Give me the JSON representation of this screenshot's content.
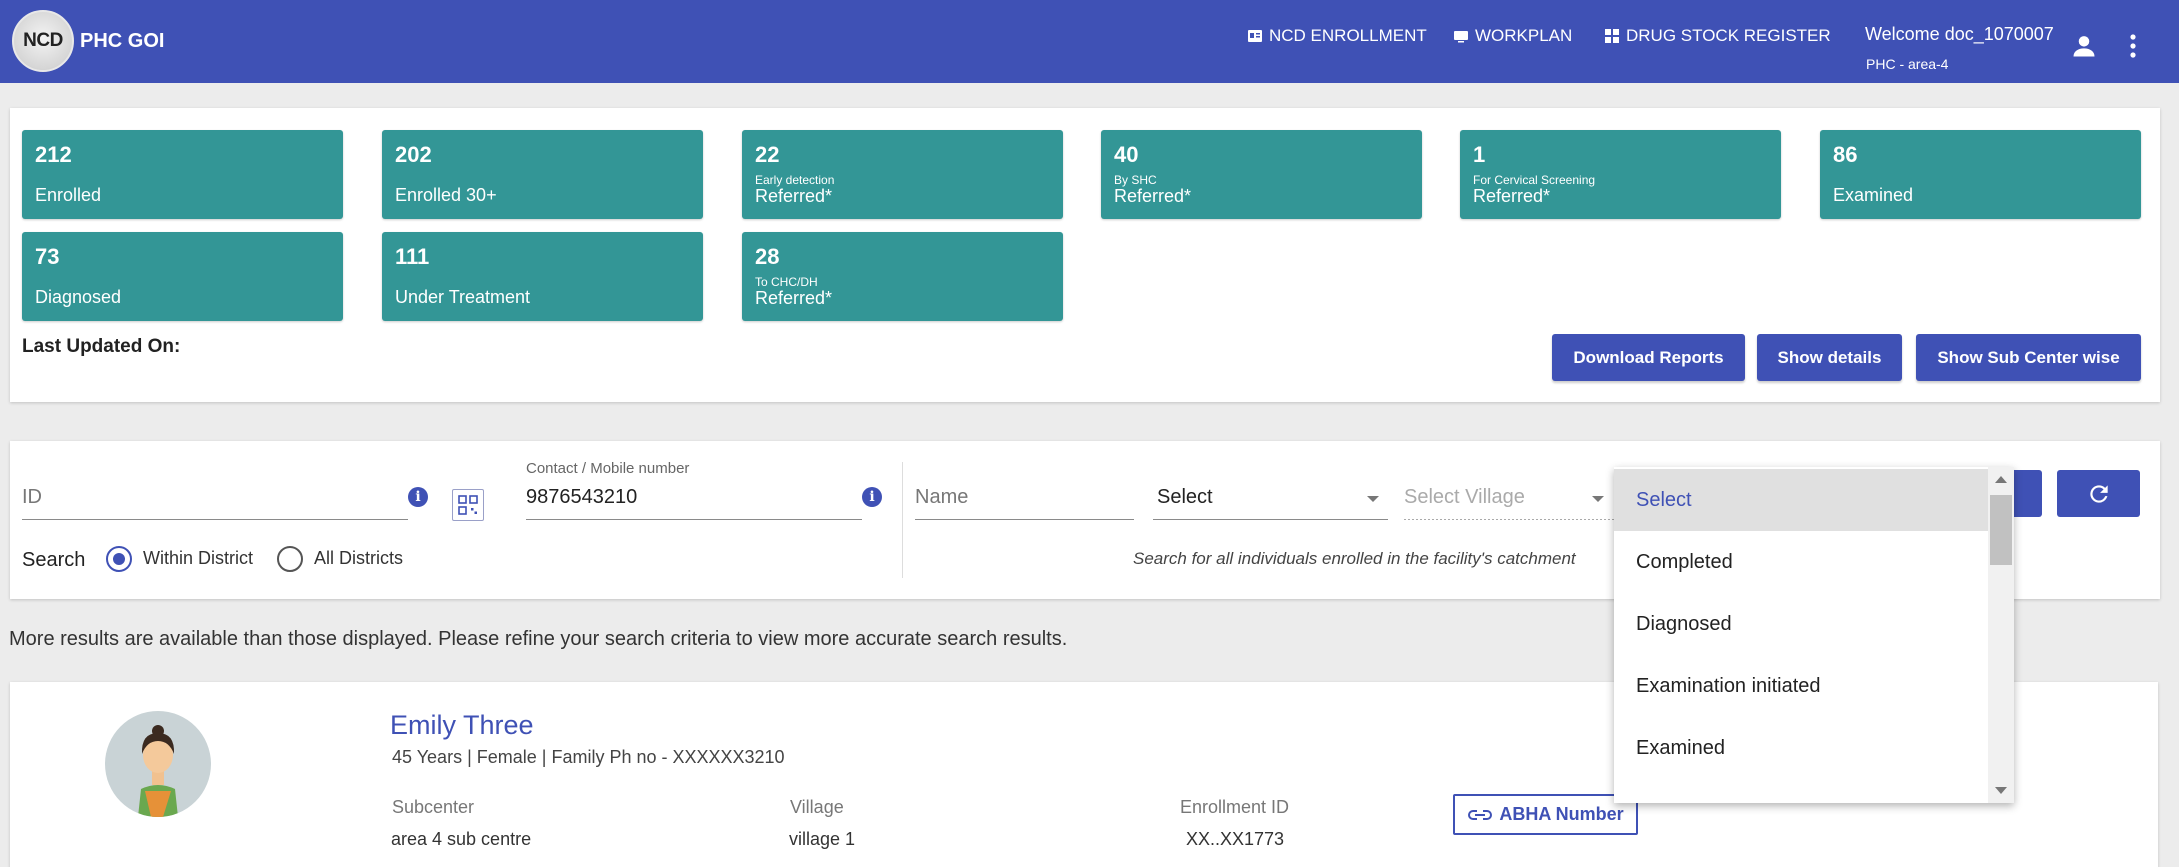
{
  "header": {
    "logo_text": "NCD",
    "app_title": "PHC GOI",
    "nav": [
      {
        "label": "NCD ENROLLMENT",
        "icon": "id-card-icon"
      },
      {
        "label": "WORKPLAN",
        "icon": "monitor-icon"
      },
      {
        "label": "DRUG STOCK REGISTER",
        "icon": "grid-icon"
      }
    ],
    "welcome": "Welcome doc_1070007",
    "facility": "PHC - area-4",
    "colors": {
      "primary": "#3f51b5",
      "card": "#339696"
    }
  },
  "stats": {
    "cards": [
      {
        "value": "212",
        "sub": "",
        "label": "Enrolled"
      },
      {
        "value": "202",
        "sub": "",
        "label": "Enrolled 30+"
      },
      {
        "value": "22",
        "sub": "Early detection",
        "label": "Referred*"
      },
      {
        "value": "40",
        "sub": "By SHC",
        "label": "Referred*"
      },
      {
        "value": "1",
        "sub": "For Cervical Screening",
        "label": "Referred*"
      },
      {
        "value": "86",
        "sub": "",
        "label": "Examined"
      },
      {
        "value": "73",
        "sub": "",
        "label": "Diagnosed"
      },
      {
        "value": "111",
        "sub": "",
        "label": "Under Treatment"
      },
      {
        "value": "28",
        "sub": "To CHC/DH",
        "label": "Referred*"
      }
    ],
    "last_updated": "Last Updated On:",
    "buttons": {
      "download": "Download Reports",
      "details": "Show details",
      "subcenter": "Show Sub Center wise"
    }
  },
  "search": {
    "id_placeholder": "ID",
    "mobile_label": "Contact / Mobile number",
    "mobile_value": "9876543210",
    "name_placeholder": "Name",
    "select_value": "Select",
    "village_placeholder": "Select Village",
    "search_label": "Search",
    "radio_within": "Within District",
    "radio_all": "All Districts",
    "hint": "Search for all individuals enrolled in the facility's catchment"
  },
  "dropdown": {
    "options": [
      "Select",
      "Completed",
      "Diagnosed",
      "Examination initiated",
      "Examined"
    ],
    "selected_index": 0
  },
  "results": {
    "notice": "More results are available than those displayed. Please refine your search criteria to view more accurate search results.",
    "items": [
      {
        "name": "Emily Three",
        "meta": "45 Years | Female | Family Ph no - XXXXXX3210",
        "subcenter_label": "Subcenter",
        "subcenter": "area 4 sub centre",
        "village_label": "Village",
        "village": "village 1",
        "enrollment_label": "Enrollment ID",
        "enrollment_id": "XX..XX1773",
        "abha_label": "ABHA Number"
      }
    ]
  }
}
